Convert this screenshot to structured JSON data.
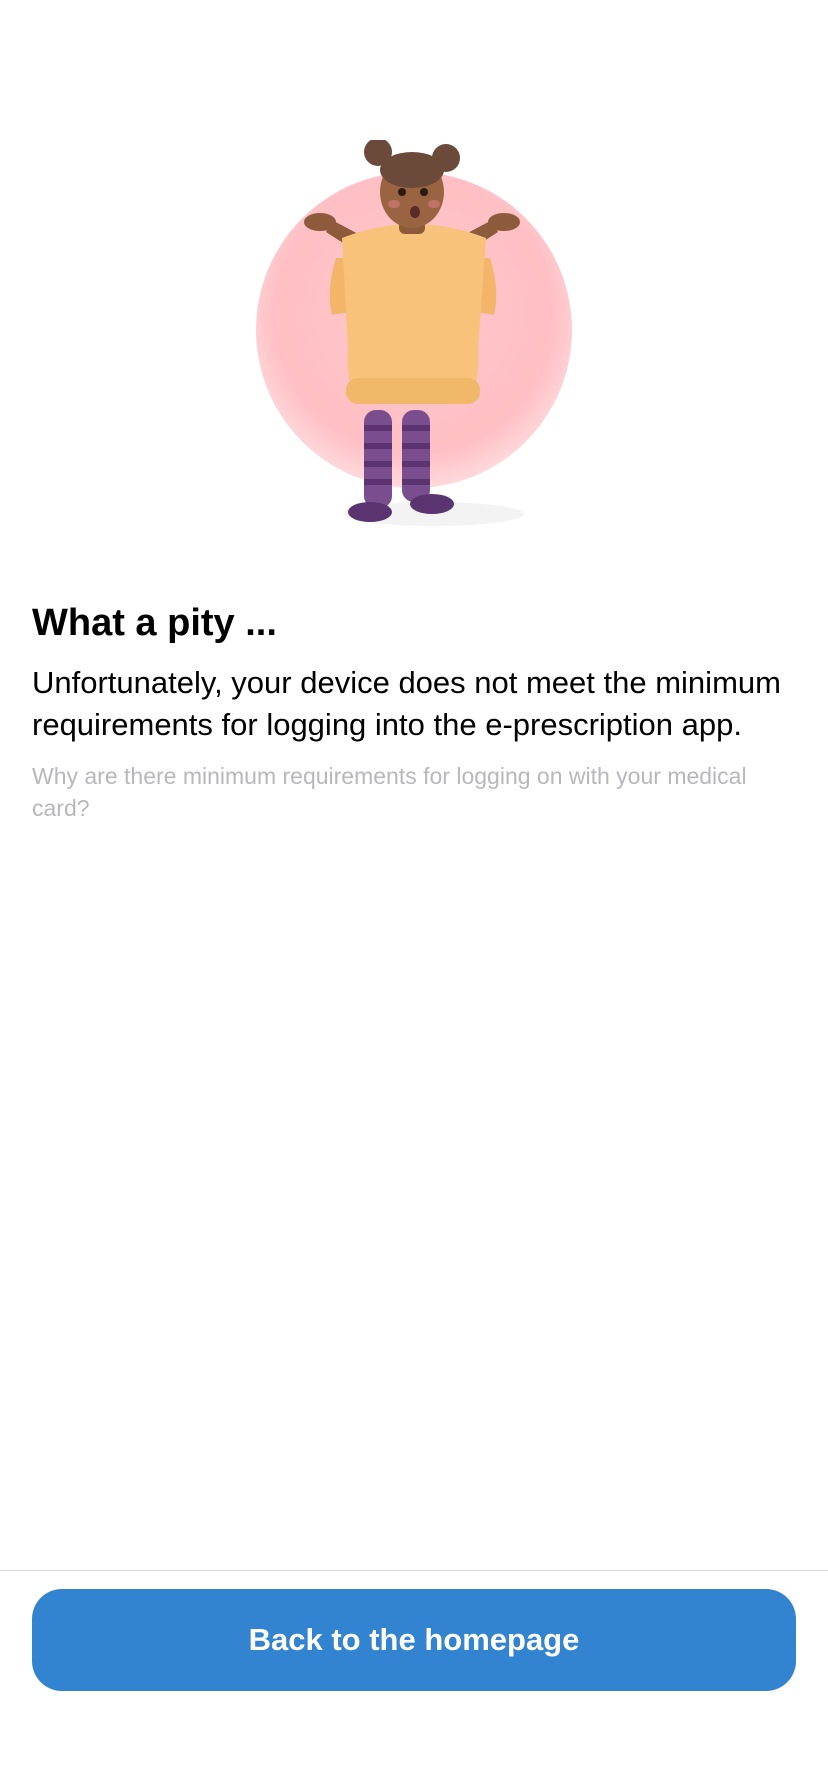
{
  "screen": {
    "title": "What a pity ...",
    "message": "Unfortunately, your device does not meet the minimum requirements for logging into the e-prescription app.",
    "info_link": "Why are there minimum requirements for logging on with your medical card?"
  },
  "illustration": {
    "icon": "shrugging-girl-illustration",
    "circle_color": "#ffc4c8",
    "sweater_color": "#f8c27a",
    "stockings_color": "#7a4d8f"
  },
  "footer": {
    "primary_button_label": "Back to the homepage",
    "primary_button_color": "#3283d0"
  }
}
